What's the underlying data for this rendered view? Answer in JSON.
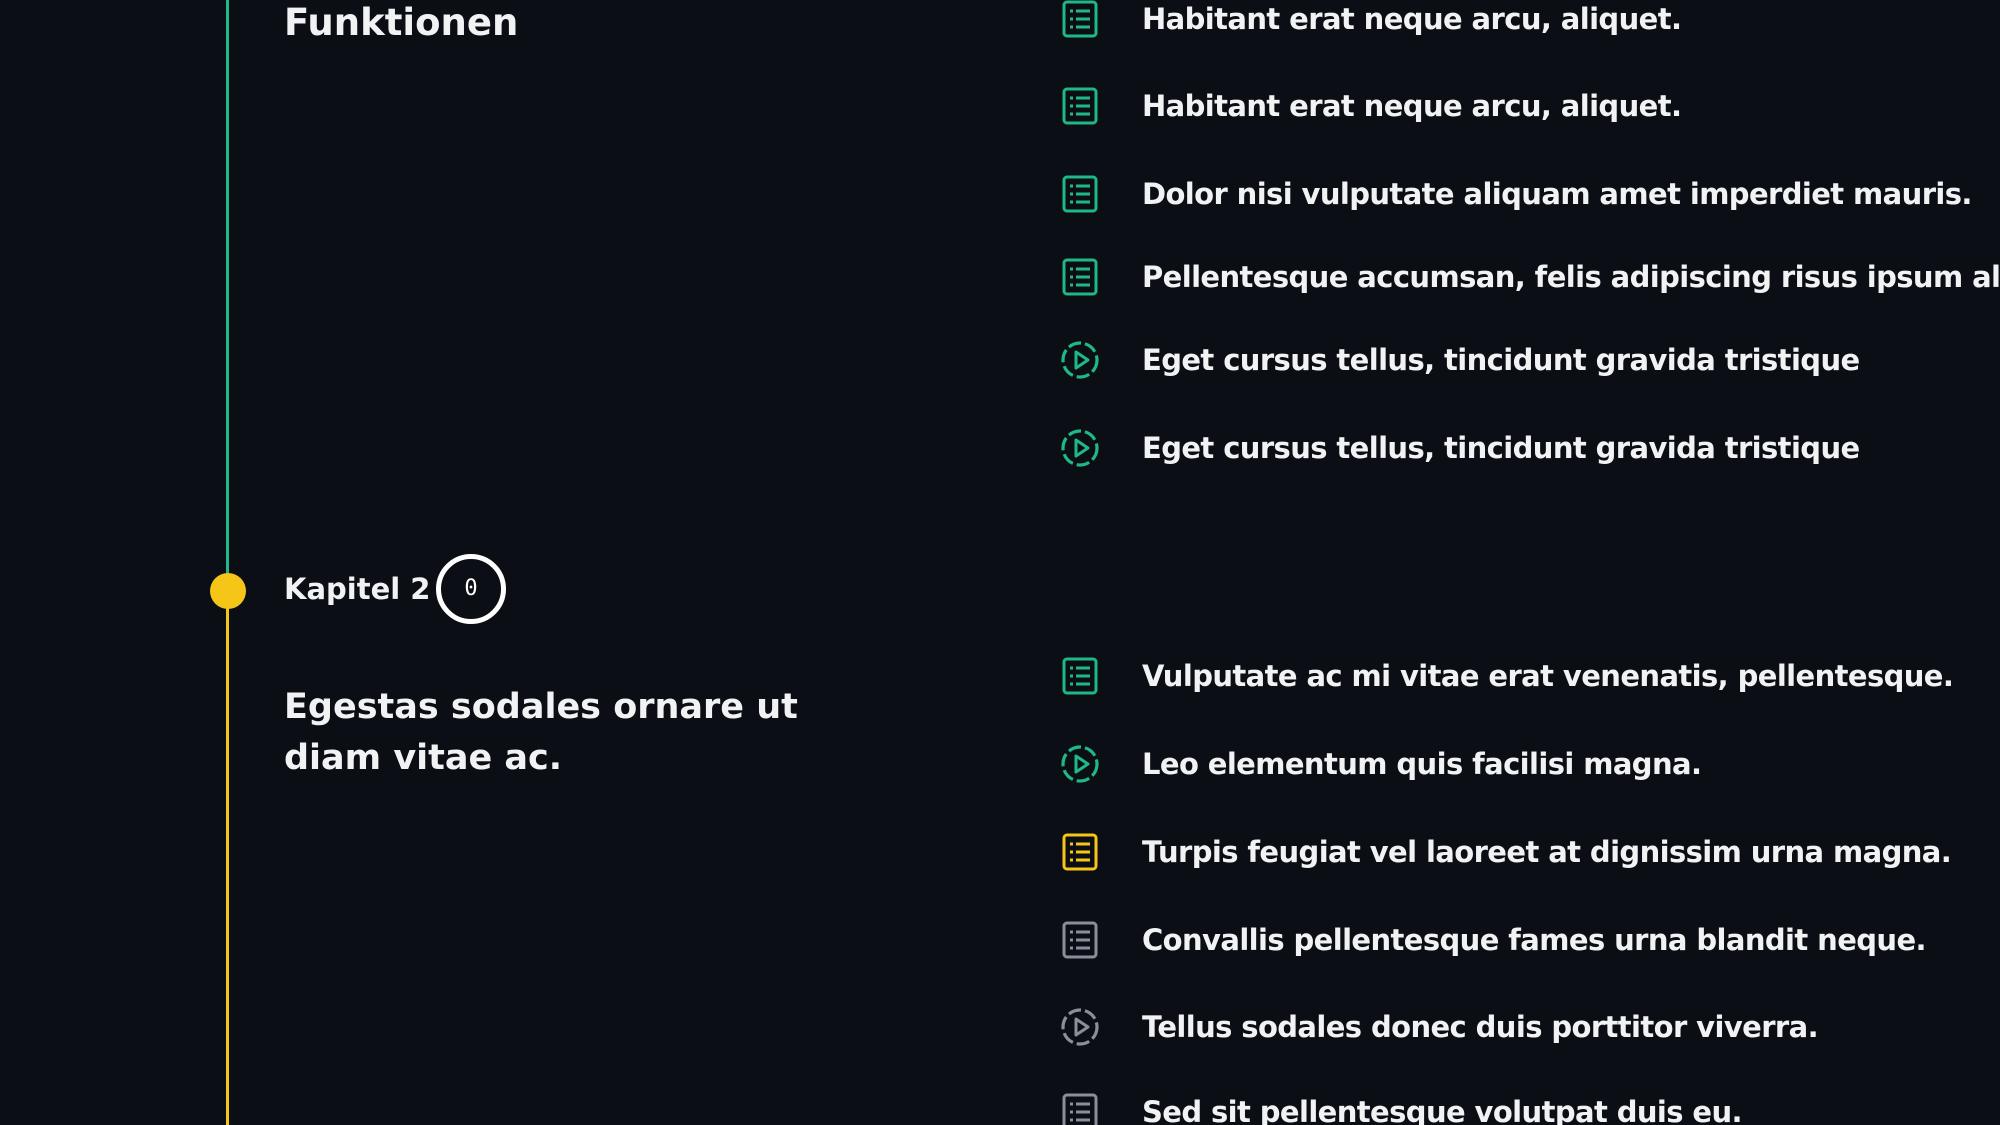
{
  "colors": {
    "background": "#0b0e14",
    "completed": "#1fb88a",
    "current": "#f5c518",
    "pending": "#8b8f9b",
    "text": "#f1f2f4"
  },
  "section_1": {
    "title": "Funktionen"
  },
  "section_2": {
    "label": "Kapitel 2",
    "count": "0",
    "title": "Egestas sodales ornare ut diam vitae ac."
  },
  "lessons_section_1": [
    {
      "label": "Habitant erat neque arcu, aliquet.",
      "icon": "list-icon",
      "status": "completed"
    },
    {
      "label": "Habitant erat neque arcu, aliquet.",
      "icon": "list-icon",
      "status": "completed"
    },
    {
      "label": "Dolor nisi vulputate aliquam amet imperdiet mauris.",
      "icon": "list-icon",
      "status": "completed"
    },
    {
      "label": "Pellentesque accumsan, felis adipiscing risus ipsum aliqu",
      "icon": "list-icon",
      "status": "completed"
    },
    {
      "label": "Eget cursus tellus, tincidunt gravida tristique",
      "icon": "play-icon",
      "status": "completed"
    },
    {
      "label": "Eget cursus tellus, tincidunt gravida tristique",
      "icon": "play-icon",
      "status": "completed"
    }
  ],
  "lessons_section_2": [
    {
      "label": "Vulputate ac mi vitae erat venenatis, pellentesque.",
      "icon": "list-icon",
      "status": "completed"
    },
    {
      "label": "Leo elementum quis facilisi magna.",
      "icon": "play-icon",
      "status": "completed"
    },
    {
      "label": "Turpis feugiat vel laoreet at dignissim urna magna.",
      "icon": "list-icon",
      "status": "current"
    },
    {
      "label": "Convallis pellentesque fames urna blandit neque.",
      "icon": "list-icon",
      "status": "pending"
    },
    {
      "label": "Tellus sodales donec duis porttitor viverra.",
      "icon": "play-icon",
      "status": "pending"
    },
    {
      "label": "Sed sit pellentesque volutpat duis eu.",
      "icon": "list-icon",
      "status": "pending"
    }
  ]
}
